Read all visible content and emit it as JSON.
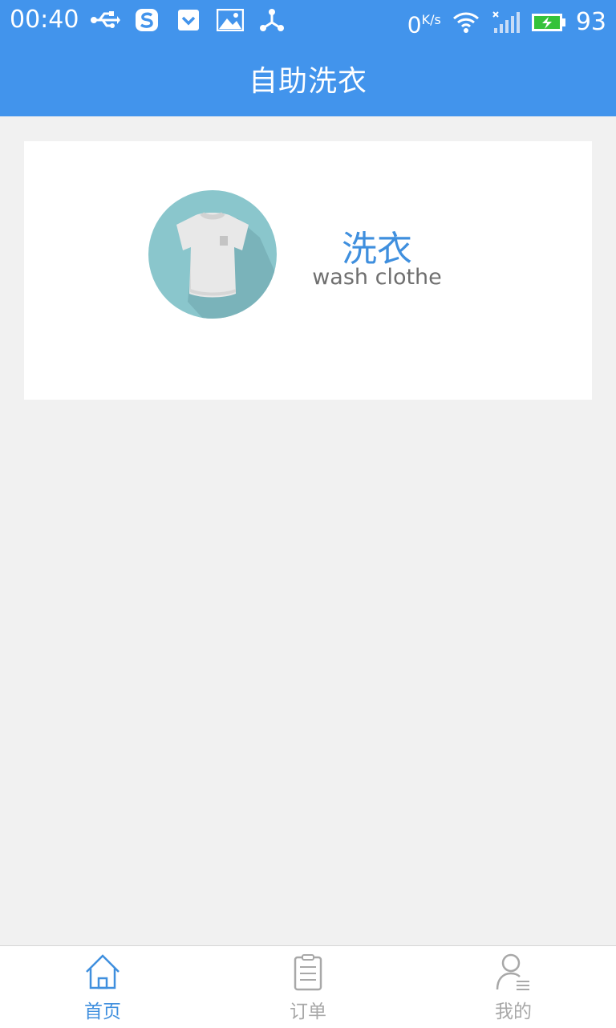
{
  "status_bar": {
    "time": "00:40",
    "speed_value": "0",
    "speed_unit": "K/s",
    "battery_level": "93",
    "icons": [
      "usb-icon",
      "sogou-icon",
      "pocket-icon",
      "image-icon",
      "share-icon",
      "wifi-icon",
      "signal-icon",
      "battery-icon"
    ]
  },
  "header": {
    "title": "自助洗衣"
  },
  "main": {
    "wash": {
      "title": "洗衣",
      "subtitle": "wash clothe",
      "icon": "tshirt-icon"
    }
  },
  "tabs": [
    {
      "label": "首页",
      "icon": "home-icon",
      "active": true
    },
    {
      "label": "订单",
      "icon": "order-icon",
      "active": false
    },
    {
      "label": "我的",
      "icon": "profile-icon",
      "active": false
    }
  ],
  "colors": {
    "accent": "#4294ec",
    "active_tab": "#3f8fde",
    "inactive_tab": "#a8a8a8",
    "background": "#f1f1f1",
    "icon_circle": "#8ac6cc"
  }
}
